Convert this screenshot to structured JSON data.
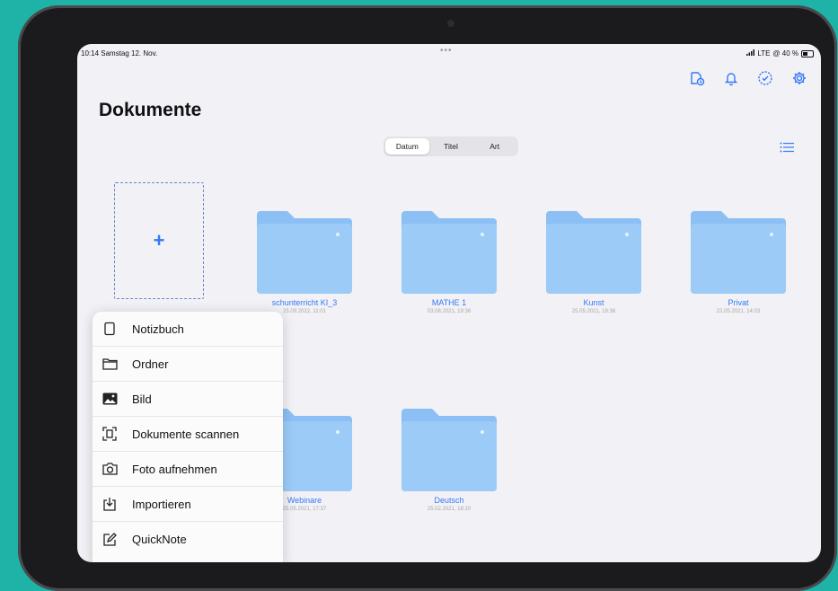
{
  "status_bar": {
    "time_date": "10:14 Samstag 12. Nov.",
    "dots": "•••",
    "network": "LTE",
    "battery": "@ 40 %"
  },
  "header": {
    "title": "Dokumente",
    "icons": [
      "cloud-clock-icon",
      "bell-icon",
      "checkmark-circle-icon",
      "gear-icon"
    ]
  },
  "sort": {
    "options": [
      "Datum",
      "Titel",
      "Art"
    ],
    "selected": "Datum"
  },
  "new_item": {
    "label": "+"
  },
  "folders": [
    {
      "name": "schunterricht KI_3",
      "date": "25.09.2022, 11:01"
    },
    {
      "name": "MATHE 1",
      "date": "03.08.2021, 19:36"
    },
    {
      "name": "Kunst",
      "date": "25.05.2021, 19:36"
    },
    {
      "name": "Privat",
      "date": "22.05.2021, 14:03"
    },
    {
      "name": "Webinare",
      "date": "25.05.2021, 17:37"
    },
    {
      "name": "Deutsch",
      "date": "25.02.2021, 18:20"
    }
  ],
  "menu": {
    "items": [
      {
        "label": "Notizbuch",
        "icon": "notebook-icon"
      },
      {
        "label": "Ordner",
        "icon": "folder-icon"
      },
      {
        "label": "Bild",
        "icon": "image-icon"
      },
      {
        "label": "Dokumente scannen",
        "icon": "scan-icon"
      },
      {
        "label": "Foto aufnehmen",
        "icon": "camera-icon"
      },
      {
        "label": "Importieren",
        "icon": "import-icon"
      },
      {
        "label": "QuickNote",
        "icon": "quicknote-icon"
      }
    ]
  },
  "colors": {
    "background": "#1fb3a7",
    "accent": "#3478f6",
    "folder": "#8cc0f5"
  }
}
